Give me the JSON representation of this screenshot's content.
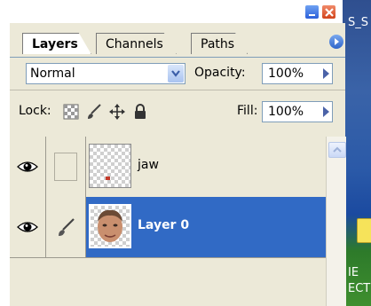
{
  "desktop": {
    "top_text": "S_S",
    "bottom_text_1": "IE",
    "bottom_text_2": "ECT"
  },
  "window_controls": {
    "minimize_icon": "minimize-icon",
    "close_icon": "close-x-icon",
    "minimize_color": "#2b5fd9",
    "close_color": "#d2441b"
  },
  "tabs": {
    "layers": "Layers",
    "channels": "Channels",
    "paths": "Paths",
    "active": "Layers"
  },
  "blend": {
    "mode": "Normal",
    "opacity_label": "Opacity:",
    "opacity_value": "100%"
  },
  "lock": {
    "label": "Lock:",
    "fill_label": "Fill:",
    "fill_value": "100%",
    "icons": [
      "lock-transparent-icon",
      "lock-image-icon",
      "lock-position-icon",
      "lock-all-icon"
    ]
  },
  "layers": [
    {
      "name": "jaw",
      "visible": true,
      "linked_icon": "none",
      "selected": false
    },
    {
      "name": "Layer 0",
      "visible": true,
      "linked_icon": "brush-icon",
      "selected": true
    }
  ],
  "colors": {
    "panel_bg": "#ece9d8",
    "selection": "#316ac5",
    "accent_blue": "#4b63a8"
  }
}
